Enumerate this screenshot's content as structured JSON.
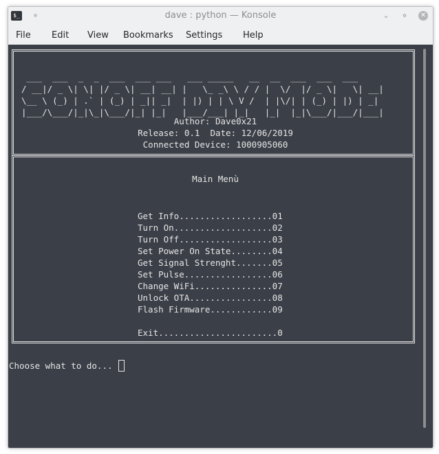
{
  "window": {
    "title": "dave : python — Konsole",
    "app_icon_glyph": "$_",
    "buttons": {
      "minimize": "⌄",
      "maximize": "⋄",
      "close": "✕"
    }
  },
  "menubar": [
    "File",
    "Edit",
    "View",
    "Bookmarks",
    "Settings",
    "Help"
  ],
  "banner": [
    " ___  ___  _  _  ___  ___ ___   ___ _____   __  __  ___  ___  ___ ",
    "/ __|/ _ \\| \\| |/ _ \\| __| __| |   \\_ _\\ \\ / / |  \\/  |/ _ \\|   \\| __|",
    "\\__ \\ (_) | .` | (_) | _|| _|  | |) | | \\ V /  | |\\/| | (_) | |) | _| ",
    "|___/\\___/|_|\\_|\\___/|_| |_|   |___/___| |_|   |_|  |_|\\___/|___/|___|"
  ],
  "info": {
    "author": "Author: Dave0x21",
    "release": "Release: 0.1  Date: 12/06/2019",
    "device": "Connected Device: 1000905060"
  },
  "menu": {
    "title": "Main Menù",
    "items": [
      "Get Info..................01",
      "Turn On...................02",
      "Turn Off..................03",
      "Set Power On State........04",
      "Get Signal Strenght.......05",
      "Set Pulse.................06",
      "Change WiFi...............07",
      "Unlock OTA................08",
      "Flash Firmware............09"
    ],
    "exit": "Exit.......................0"
  },
  "prompt": "Choose what to do... "
}
